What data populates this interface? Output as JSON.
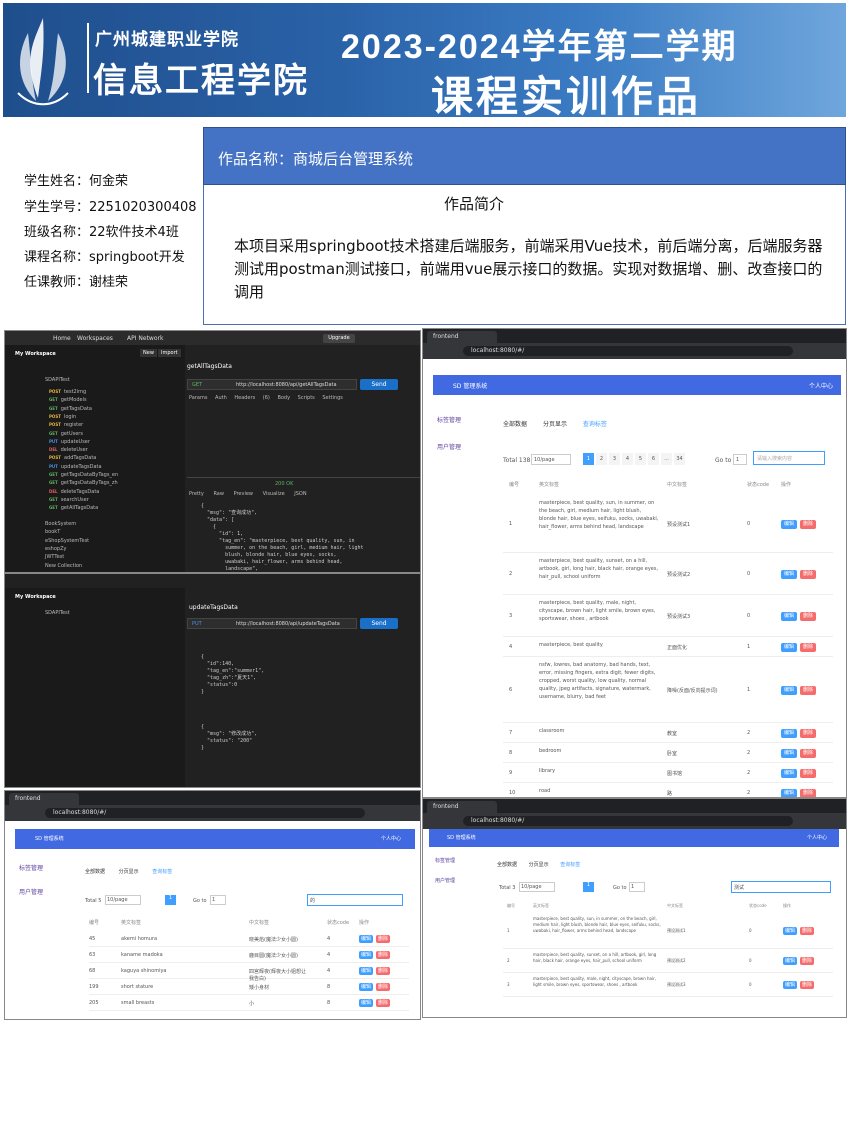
{
  "banner": {
    "school": "广州城建职业学院",
    "college": "信息工程学院",
    "term": "2023-2024学年第二学期",
    "title": "课程实训作品"
  },
  "student": {
    "name": "学生姓名：何金荣",
    "id": "学生学号：2251020300408",
    "class": "班级名称：22软件技术4班",
    "course": "课程名称：springboot开发",
    "teacher": "任课教师：谢桂荣"
  },
  "work": {
    "name": "作品名称：商城后台管理系统",
    "intro_title": "作品简介",
    "intro": "本项目采用springboot技术搭建后端服务，前端采用Vue技术，前后端分离，后端服务器测试用postman测试接口，前端用vue展示接口的数据。实现对数据增、删、改查接口的调用"
  },
  "postman1": {
    "nav": [
      "Home",
      "Workspaces",
      "API Network"
    ],
    "workspace": "My Workspace",
    "new": "New",
    "import": "Import",
    "collection": "SDAPITest",
    "items": [
      {
        "m": "POST",
        "n": "test2img"
      },
      {
        "m": "GET",
        "n": "getModels"
      },
      {
        "m": "GET",
        "n": "getTagsData"
      },
      {
        "m": "POST",
        "n": "login"
      },
      {
        "m": "POST",
        "n": "register"
      },
      {
        "m": "GET",
        "n": "getUsers"
      },
      {
        "m": "PUT",
        "n": "updateUser"
      },
      {
        "m": "DEL",
        "n": "deleteUser"
      },
      {
        "m": "POST",
        "n": "addTagsData"
      },
      {
        "m": "PUT",
        "n": "updateTagsData"
      },
      {
        "m": "GET",
        "n": "getTagsDataByTags_en"
      },
      {
        "m": "GET",
        "n": "getTagsDataByTags_zh"
      },
      {
        "m": "DEL",
        "n": "deleteTagsData"
      },
      {
        "m": "GET",
        "n": "searchUser"
      },
      {
        "m": "GET",
        "n": "getAllTagsData"
      }
    ],
    "folders": [
      "BookSystem",
      "bookT",
      "eShopSystemTest",
      "eshopZy",
      "JWTTest",
      "New Collection"
    ],
    "req_name": "getAllTagsData",
    "method": "GET",
    "url": "http://localhost:8080/api/getAllTagsData",
    "send": "Send",
    "tabs": [
      "Params",
      "Auth",
      "Headers (6)",
      "Body",
      "Scripts",
      "Settings"
    ],
    "status": "200 OK",
    "resp_tabs": [
      "Pretty",
      "Raw",
      "Preview",
      "Visualize",
      "JSON"
    ],
    "code": "{\n  \"msg\": \"查询成功\",\n  \"data\": [\n    {\n      \"id\": 1,\n      \"tag_en\": \"masterpiece, best quality, sun, in\n        summer, on the beach, girl, medium hair, light\n        blush, blonde hair, blue eyes, socks,\n        uwabaki, hair_flower, arms behind head,\n        landscape\",\n      \"tag_zh\": \"预设测试1\",\n      \"status\": 0"
  },
  "postman2": {
    "req_name": "updateTagsData",
    "method": "PUT",
    "url": "http://localhost:8080/api/updateTagsData",
    "send": "Send",
    "code": "{\n  \"id\":140,\n  \"tag_en\":\"summer1\",\n  \"tag_zh\":\"夏天1\",\n  \"status\":0\n}",
    "resp": "{\n  \"msg\": \"修改成功\",\n  \"status\": \"200\"\n}"
  },
  "vue1": {
    "tab": "frontend",
    "url": "localhost:8080/#/",
    "app": "SD 管理系统",
    "user": "个人中心",
    "menu": [
      "标签管理",
      "用户管理"
    ],
    "tabs": [
      "全部数据",
      "分页显示",
      "查询标签"
    ],
    "total": "Total 138",
    "page_size": "10/page",
    "pages": [
      "1",
      "2",
      "3",
      "4",
      "5",
      "6",
      "...",
      "34"
    ],
    "goto": "Go to",
    "goto_val": "1",
    "search_ph": "请输入搜索内容",
    "cols": [
      "编号",
      "英文标签",
      "中文标签",
      "状态code",
      "操作"
    ],
    "edit": "编辑",
    "del": "删除",
    "rows": [
      {
        "id": "1",
        "en": "masterpiece, best quality, sun, in summer, on the beach, girl, medium hair, light blush, blonde hair, blue eyes, seifuku, socks, uwabaki, hair_flower, arms behind head, landscape",
        "zh": "预设测试1",
        "s": "0"
      },
      {
        "id": "2",
        "en": "masterpiece, best quality, sunset, on a hill, artbook, girl, long hair, black hair, orange eyes, hair_pull, school uniform",
        "zh": "预设测试2",
        "s": "0"
      },
      {
        "id": "3",
        "en": "masterpiece, best quality, male, night, cityscape, brown hair, light smile, brown eyes, sportswear, shoes , artbook",
        "zh": "预设测试3",
        "s": "0"
      },
      {
        "id": "4",
        "en": "masterpiece, best quality",
        "zh": "正面优化",
        "s": "1"
      },
      {
        "id": "6",
        "en": "nsfw, lowres, bad anatomy, bad hands, text, error, missing fingers, extra digit, fewer digits, cropped, worst quality, low quality, normal quality, jpeg artifacts, signature, watermark, username, blurry, bad feet",
        "zh": "降噪(反面/反向提示词)",
        "s": "1"
      },
      {
        "id": "7",
        "en": "classroom",
        "zh": "教室",
        "s": "2"
      },
      {
        "id": "8",
        "en": "bedroom",
        "zh": "卧室",
        "s": "2"
      },
      {
        "id": "9",
        "en": "library",
        "zh": "图书馆",
        "s": "2"
      },
      {
        "id": "10",
        "en": "road",
        "zh": "路",
        "s": "2"
      }
    ]
  },
  "vue2": {
    "tab": "frontend",
    "url": "localhost:8080/#/",
    "app": "SD 管理系统",
    "user": "个人中心",
    "total": "Total 5",
    "page_size": "10/page",
    "goto": "Go to",
    "goto_val": "1",
    "search": "的",
    "rows": [
      {
        "id": "45",
        "en": "akemi homura",
        "zh": "晓美焰(魔法少女小圆)",
        "s": "4"
      },
      {
        "id": "63",
        "en": "kaname madoka",
        "zh": "鹿目圆(魔法少女小圆)",
        "s": "4"
      },
      {
        "id": "68",
        "en": "kaguya shinomiya",
        "zh": "四宫辉夜(辉夜大小姐想让我告白)",
        "s": "4"
      },
      {
        "id": "199",
        "en": "short stature",
        "zh": "矮小身材",
        "s": "8"
      },
      {
        "id": "205",
        "en": "small breasts",
        "zh": "小",
        "s": "8"
      }
    ]
  },
  "vue3": {
    "tab": "frontend",
    "url": "localhost:8080/#/",
    "app": "SD 管理系统",
    "user": "个人中心",
    "total": "Total 3",
    "page_size": "10/page",
    "goto": "Go to",
    "goto_val": "1",
    "search": "测试",
    "rows": [
      {
        "id": "1",
        "en": "masterpiece, best quality, sun, in summer, on the beach, girl, medium hair, light blush, blonde hair, blue eyes, seifuku, socks, uwabaki, hair_flower, arms behind head, landscape",
        "zh": "预设测试1",
        "s": "0"
      },
      {
        "id": "2",
        "en": "masterpiece, best quality, sunset, on a hill, artbook, girl, long hair, black hair, orange eyes, hair_pull, school uniform",
        "zh": "预设测试2",
        "s": "0"
      },
      {
        "id": "3",
        "en": "masterpiece, best quality, male, night, cityscape, brown hair, light smile, brown eyes, sportswear, shoes , artbook",
        "zh": "预设测试3",
        "s": "0"
      }
    ]
  }
}
